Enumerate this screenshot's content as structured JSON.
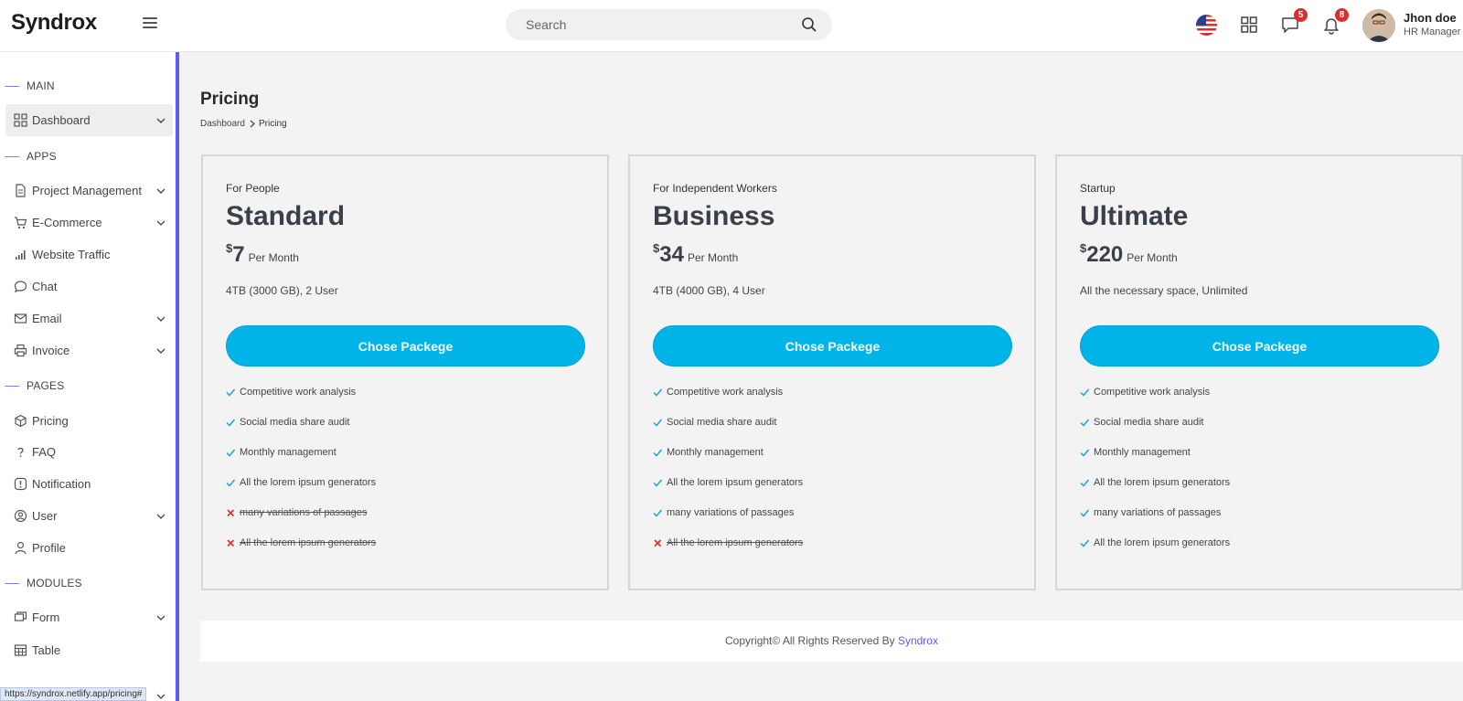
{
  "header": {
    "brand": "Syndrox",
    "search_placeholder": "Search",
    "messages_count": "5",
    "notifications_count": "8",
    "user_name": "Jhon doe",
    "user_role": "HR Manager"
  },
  "sidebar": {
    "sections": [
      "MAIN",
      "APPS",
      "PAGES",
      "MODULES"
    ],
    "items": [
      {
        "label": "Dashboard",
        "icon": "grid-icon"
      },
      {
        "label": "Project Management",
        "icon": "document-icon"
      },
      {
        "label": "E-Commerce",
        "icon": "cart-icon"
      },
      {
        "label": "Website Traffic",
        "icon": "bar-chart-icon"
      },
      {
        "label": "Chat",
        "icon": "chat-bubble-icon"
      },
      {
        "label": "Email",
        "icon": "mail-icon"
      },
      {
        "label": "Invoice",
        "icon": "printer-icon"
      },
      {
        "label": "Pricing",
        "icon": "package-icon"
      },
      {
        "label": "FAQ",
        "icon": "question-icon"
      },
      {
        "label": "Notification",
        "icon": "alert-icon"
      },
      {
        "label": "User",
        "icon": "user-circle-icon"
      },
      {
        "label": "Profile",
        "icon": "person-icon"
      },
      {
        "label": "Form",
        "icon": "form-icon"
      },
      {
        "label": "Table",
        "icon": "table-icon"
      }
    ]
  },
  "status_url": "https://syndrox.netlify.app/pricing#",
  "page": {
    "title": "Pricing",
    "breadcrumb": [
      "Dashboard",
      "Pricing"
    ]
  },
  "plans": [
    {
      "for": "For People",
      "name": "Standard",
      "currency": "$",
      "price": "7",
      "period": "Per Month",
      "storage": "4TB (3000 GB), 2 User",
      "cta": "Chose Packege",
      "features": [
        {
          "text": "Competitive work analysis",
          "included": true
        },
        {
          "text": "Social media share audit",
          "included": true
        },
        {
          "text": "Monthly management",
          "included": true
        },
        {
          "text": "All the lorem ipsum generators",
          "included": true
        },
        {
          "text": "many variations of passages",
          "included": false
        },
        {
          "text": "All the lorem ipsum generators",
          "included": false
        }
      ]
    },
    {
      "for": "For Independent Workers",
      "name": "Business",
      "currency": "$",
      "price": "34",
      "period": "Per Month",
      "storage": "4TB (4000 GB), 4 User",
      "cta": "Chose Packege",
      "features": [
        {
          "text": "Competitive work analysis",
          "included": true
        },
        {
          "text": "Social media share audit",
          "included": true
        },
        {
          "text": "Monthly management",
          "included": true
        },
        {
          "text": "All the lorem ipsum generators",
          "included": true
        },
        {
          "text": "many variations of passages",
          "included": true
        },
        {
          "text": "All the lorem ipsum generators",
          "included": false
        }
      ]
    },
    {
      "for": "Startup",
      "name": "Ultimate",
      "currency": "$",
      "price": "220",
      "period": "Per Month",
      "storage": "All the necessary space, Unlimited",
      "cta": "Chose Packege",
      "features": [
        {
          "text": "Competitive work analysis",
          "included": true
        },
        {
          "text": "Social media share audit",
          "included": true
        },
        {
          "text": "Monthly management",
          "included": true
        },
        {
          "text": "All the lorem ipsum generators",
          "included": true
        },
        {
          "text": "many variations of passages",
          "included": true
        },
        {
          "text": "All the lorem ipsum generators",
          "included": true
        }
      ]
    }
  ],
  "footer": {
    "text": "Copyright© All Rights Reserved By",
    "link": "Syndrox"
  },
  "colors": {
    "accent": "#5b5cf0",
    "button": "#00b4e8",
    "check": "#1aa5d6",
    "cross": "#e12b2b",
    "badge": "#e12b2b"
  }
}
